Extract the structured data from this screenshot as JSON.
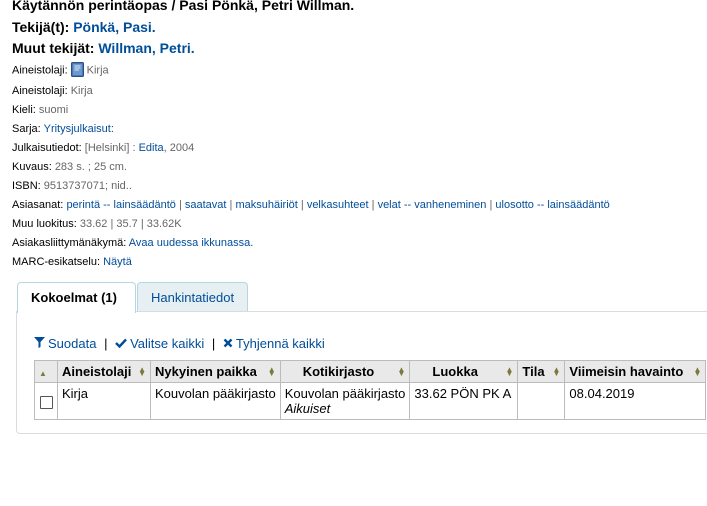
{
  "record": {
    "title": "Käytännön perintäopas / Pasi Pönkä, Petri Willman.",
    "author_label": "Tekijä(t):",
    "author_value": "Pönkä, Pasi.",
    "other_authors_label": "Muut tekijät:",
    "other_authors_value": "Willman, Petri.",
    "material_type_icon_label": "Aineistolaji:",
    "material_type_icon_text": "Kirja",
    "material_type_label": "Aineistolaji:",
    "material_type_value": "Kirja",
    "language_label": "Kieli:",
    "language_value": "suomi",
    "series_label": "Sarja:",
    "series_value": "Yritysjulkaisut:",
    "publication_label": "Julkaisutiedot:",
    "publication_place": "[Helsinki] :",
    "publication_publisher": "Edita",
    "publication_year": ", 2004",
    "description_label": "Kuvaus:",
    "description_value": "283 s. ; 25 cm.",
    "isbn_label": "ISBN:",
    "isbn_value": "9513737071; nid..",
    "subjects_label": "Asiasanat:",
    "subjects": [
      "perintä -- lainsäädäntö",
      "saatavat",
      "maksuhäiriöt",
      "velkasuhteet",
      "velat -- vanheneminen",
      "ulosotto -- lainsäädäntö"
    ],
    "subject_separator": "|",
    "classification_label": "Muu luokitus:",
    "classification_value": "33.62 | 35.7 | 33.62K",
    "opac_view_label": "Asiakasliittymänäkymä:",
    "opac_view_link": "Avaa uudessa ikkunassa.",
    "marc_label": "MARC-esikatselu:",
    "marc_link": "Näytä"
  },
  "tabs": [
    {
      "label": "Kokoelmat (1)",
      "active": true
    },
    {
      "label": "Hankintatiedot",
      "active": false
    }
  ],
  "toolbar": {
    "filter_label": "Suodata",
    "select_all_label": "Valitse kaikki",
    "clear_all_label": "Tyhjennä kaikki",
    "separator": "|"
  },
  "table": {
    "columns": [
      "Aineistolaji",
      "Nykyinen paikka",
      "Kotikirjasto",
      "Luokka",
      "Tila",
      "Viimeisin havainto"
    ],
    "rows": [
      {
        "material_type": "Kirja",
        "current_location": "Kouvolan pääkirjasto",
        "home_library": "Kouvolan pääkirjasto",
        "home_library_collection": "Aikuiset",
        "call_number": "33.62 PÖN PK A",
        "status": "",
        "last_seen": "08.04.2019"
      }
    ]
  },
  "colors": {
    "link": "#004d99",
    "tab_border": "#b7d6e4",
    "inactive_tab_bg": "#e6f0f2",
    "table_header_bg": "#e9e9e9"
  },
  "icons": {
    "material_type": "book-icon",
    "filter": "funnel-icon",
    "select_all": "checkmark-icon",
    "clear_all": "x-icon"
  }
}
